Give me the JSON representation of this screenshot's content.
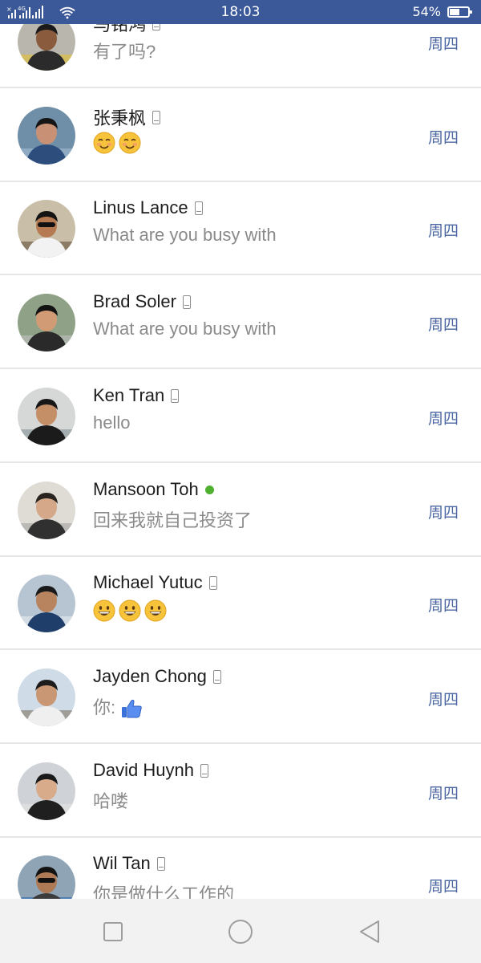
{
  "status_bar": {
    "time": "18:03",
    "battery_percent": "54%",
    "battery_level": 0.54,
    "network": "4G",
    "icons": [
      "signal-icon",
      "wifi-icon",
      "battery-icon"
    ]
  },
  "conversations": [
    {
      "name": "马铭鸿",
      "preview": "有了吗?",
      "day": "周四",
      "indicator": "phone",
      "preview_emoji": 0
    },
    {
      "name": "张秉枫",
      "preview": "",
      "day": "周四",
      "indicator": "phone",
      "preview_emoji": 2,
      "emoji_type": "smiling-blush"
    },
    {
      "name": "Linus Lance",
      "preview": "What are you busy with",
      "day": "周四",
      "indicator": "phone",
      "preview_emoji": 0
    },
    {
      "name": "Brad Soler",
      "preview": "What are you busy with",
      "day": "周四",
      "indicator": "phone",
      "preview_emoji": 0
    },
    {
      "name": "Ken Tran",
      "preview": "hello",
      "day": "周四",
      "indicator": "phone",
      "preview_emoji": 0
    },
    {
      "name": "Mansoon Toh",
      "preview": "回来我就自己投资了",
      "day": "周四",
      "indicator": "online",
      "preview_emoji": 0
    },
    {
      "name": "Michael Yutuc",
      "preview": "",
      "day": "周四",
      "indicator": "phone",
      "preview_emoji": 3,
      "emoji_type": "grinning"
    },
    {
      "name": "Jayden Chong",
      "preview": "你:",
      "day": "周四",
      "indicator": "phone",
      "preview_emoji": 0,
      "preview_icon": "thumbs-up-icon"
    },
    {
      "name": "David Huynh",
      "preview": "哈喽",
      "day": "周四",
      "indicator": "phone",
      "preview_emoji": 0
    },
    {
      "name": "Wil Tan",
      "preview": "你是做什么工作的",
      "day": "周四",
      "indicator": "phone",
      "preview_emoji": 0
    }
  ],
  "colors": {
    "status_bar": "#3b5998",
    "day_text": "#4b67a1",
    "online": "#4fb12f"
  },
  "nav_bar": {
    "buttons": [
      "square-icon",
      "circle-icon",
      "back-triangle-icon"
    ]
  }
}
